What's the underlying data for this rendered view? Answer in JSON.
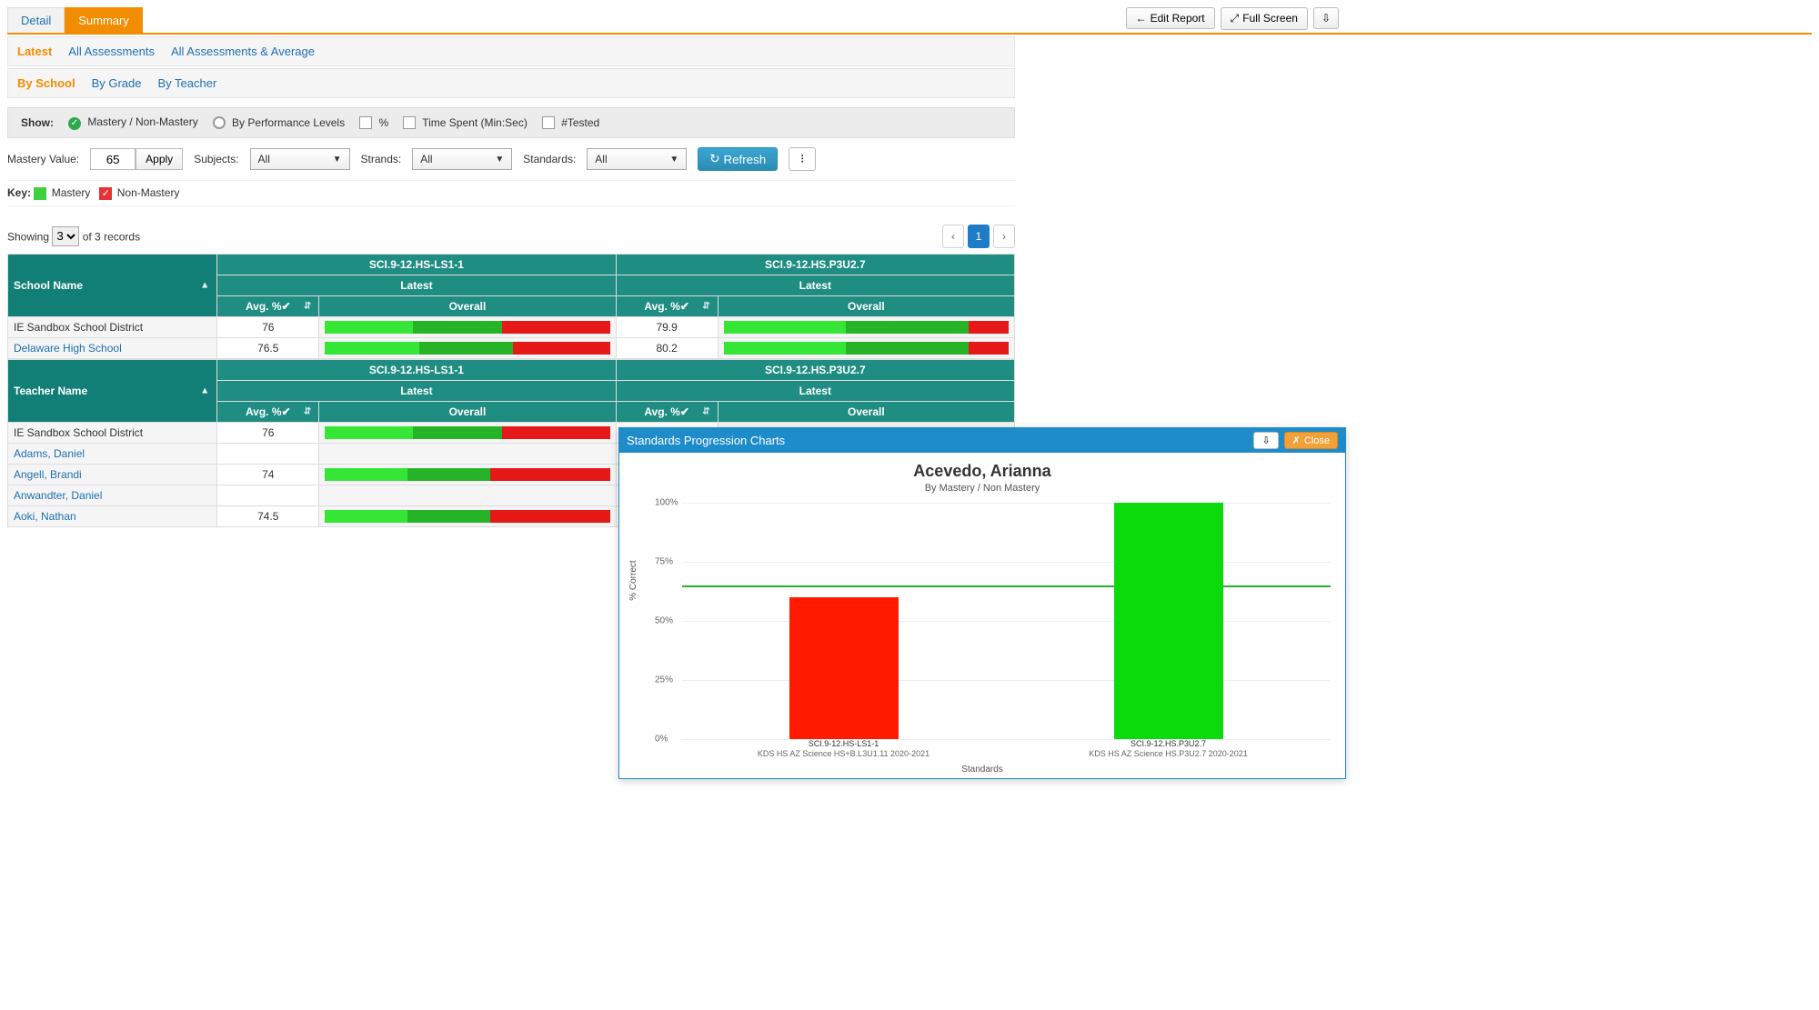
{
  "header": {
    "tabs": {
      "detail": "Detail",
      "summary": "Summary",
      "active": "summary"
    },
    "actions": {
      "edit": "Edit Report",
      "fullscreen": "Full Screen"
    }
  },
  "filter_a": {
    "items": [
      "Latest",
      "All Assessments",
      "All Assessments & Average"
    ],
    "active": 0
  },
  "filter_b": {
    "items": [
      "By School",
      "By Grade",
      "By Teacher"
    ],
    "active": 0
  },
  "show_row": {
    "label": "Show:",
    "opt_mastery": "Mastery / Non-Mastery",
    "opt_perf": "By Performance Levels",
    "opt_pct": "%",
    "opt_time": "Time Spent (Min:Sec)",
    "opt_tested": "#Tested"
  },
  "controls": {
    "mastery_label": "Mastery Value:",
    "mastery_value": "65",
    "apply": "Apply",
    "subjects_label": "Subjects:",
    "subjects_value": "All",
    "strands_label": "Strands:",
    "strands_value": "All",
    "standards_label": "Standards:",
    "standards_value": "All",
    "refresh": "Refresh"
  },
  "key": {
    "label": "Key:",
    "mastery": "Mastery",
    "nonmastery": "Non-Mastery"
  },
  "showing": {
    "prefix": "Showing",
    "value": "3",
    "suffix": "of 3 records"
  },
  "pager": {
    "current": "1"
  },
  "columns": {
    "std1": "SCI.9-12.HS-LS1-1",
    "std2": "SCI.9-12.HS.P3U2.7",
    "period": "Latest",
    "avg": "Avg. %✔",
    "overall": "Overall"
  },
  "school_table": {
    "header": "School Name",
    "rows": [
      {
        "name": "IE Sandbox School District",
        "link": false,
        "a1": "76",
        "m1": 62,
        "a2": "79.9",
        "m2": 86
      },
      {
        "name": "Delaware High School",
        "link": true,
        "a1": "76.5",
        "m1": 66,
        "a2": "80.2",
        "m2": 86
      }
    ]
  },
  "teacher_table": {
    "header": "Teacher Name",
    "rows": [
      {
        "name": "IE Sandbox School District",
        "link": false,
        "a1": "76",
        "m1": 62,
        "show2": true
      },
      {
        "name": "Adams, Daniel",
        "link": true,
        "a1": "",
        "m1": null,
        "show2": false
      },
      {
        "name": "Angell, Brandi",
        "link": true,
        "a1": "74",
        "m1": 58,
        "show2": false
      },
      {
        "name": "Anwandter, Daniel",
        "link": true,
        "a1": "",
        "m1": null,
        "show2": false
      },
      {
        "name": "Aoki, Nathan",
        "link": true,
        "a1": "74.5",
        "m1": 58,
        "show2": false
      }
    ]
  },
  "popup": {
    "title": "Standards Progression Charts",
    "close": "Close",
    "student": "Acevedo, Arianna",
    "subtitle": "By Mastery / Non Mastery",
    "ylabel": "% Correct",
    "xlabel": "Standards",
    "threshold": 65,
    "ticks": [
      "0%",
      "25%",
      "50%",
      "75%",
      "100%"
    ],
    "bars": [
      {
        "label1": "SCI.9-12.HS-LS1-1",
        "label2": "KDS HS AZ Science HS+B.L3U1.11 2020-2021",
        "value": 60,
        "color": "#ff1a00"
      },
      {
        "label1": "SCI.9-12.HS.P3U2.7",
        "label2": "KDS HS AZ Science HS.P3U2.7 2020-2021",
        "value": 100,
        "color": "#0bdb0b"
      }
    ]
  },
  "chart_data": {
    "type": "bar",
    "title": "Acevedo, Arianna",
    "subtitle": "By Mastery / Non Mastery",
    "categories": [
      "SCI.9-12.HS-LS1-1",
      "SCI.9-12.HS.P3U2.7"
    ],
    "values": [
      60,
      100
    ],
    "colors": [
      "#ff1a00",
      "#0bdb0b"
    ],
    "threshold": 65,
    "xlabel": "Standards",
    "ylabel": "% Correct",
    "ylim": [
      0,
      100
    ]
  }
}
